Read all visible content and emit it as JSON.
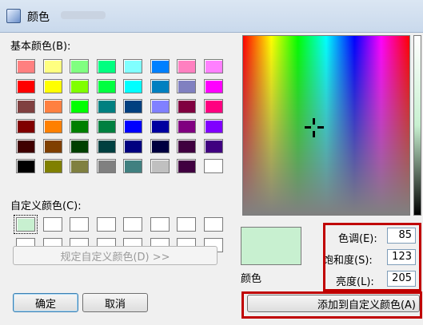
{
  "window": {
    "title": "颜色"
  },
  "basic_colors": {
    "label": "基本颜色(B):",
    "colors": [
      "#ff8080",
      "#ffff80",
      "#80ff80",
      "#00ff80",
      "#80ffff",
      "#0080ff",
      "#ff80c0",
      "#ff80ff",
      "#ff0000",
      "#ffff00",
      "#80ff00",
      "#00ff40",
      "#00ffff",
      "#0080c0",
      "#8080c0",
      "#ff00ff",
      "#804040",
      "#ff8040",
      "#00ff00",
      "#008080",
      "#004080",
      "#8080ff",
      "#800040",
      "#ff0080",
      "#800000",
      "#ff8000",
      "#008000",
      "#008040",
      "#0000ff",
      "#0000a0",
      "#800080",
      "#8000ff",
      "#400000",
      "#804000",
      "#004000",
      "#004040",
      "#000080",
      "#000040",
      "#400040",
      "#400080",
      "#000000",
      "#808000",
      "#808040",
      "#808080",
      "#408080",
      "#c0c0c0",
      "#400040",
      "#ffffff"
    ]
  },
  "custom_colors": {
    "label": "自定义颜色(C):",
    "colors": [
      "#c8f0d0",
      "#ffffff",
      "#ffffff",
      "#ffffff",
      "#ffffff",
      "#ffffff",
      "#ffffff",
      "#ffffff",
      "#ffffff",
      "#ffffff",
      "#ffffff",
      "#ffffff",
      "#ffffff",
      "#ffffff",
      "#ffffff",
      "#ffffff"
    ]
  },
  "define_custom_button": "规定自定义颜色(D) >>",
  "ok_button": "确定",
  "cancel_button": "取消",
  "preview": {
    "label": "颜色",
    "color": "#c8f0d0"
  },
  "hue": {
    "label": "色调(E):",
    "value": "85"
  },
  "saturation": {
    "label": "饱和度(S):",
    "value": "123"
  },
  "luminance": {
    "label": "亮度(L):",
    "value": "205"
  },
  "add_custom_button": "添加到自定义颜色(A)",
  "accent_colors": {
    "highlight": "#c00000",
    "default_button": "#3c7fb1"
  }
}
